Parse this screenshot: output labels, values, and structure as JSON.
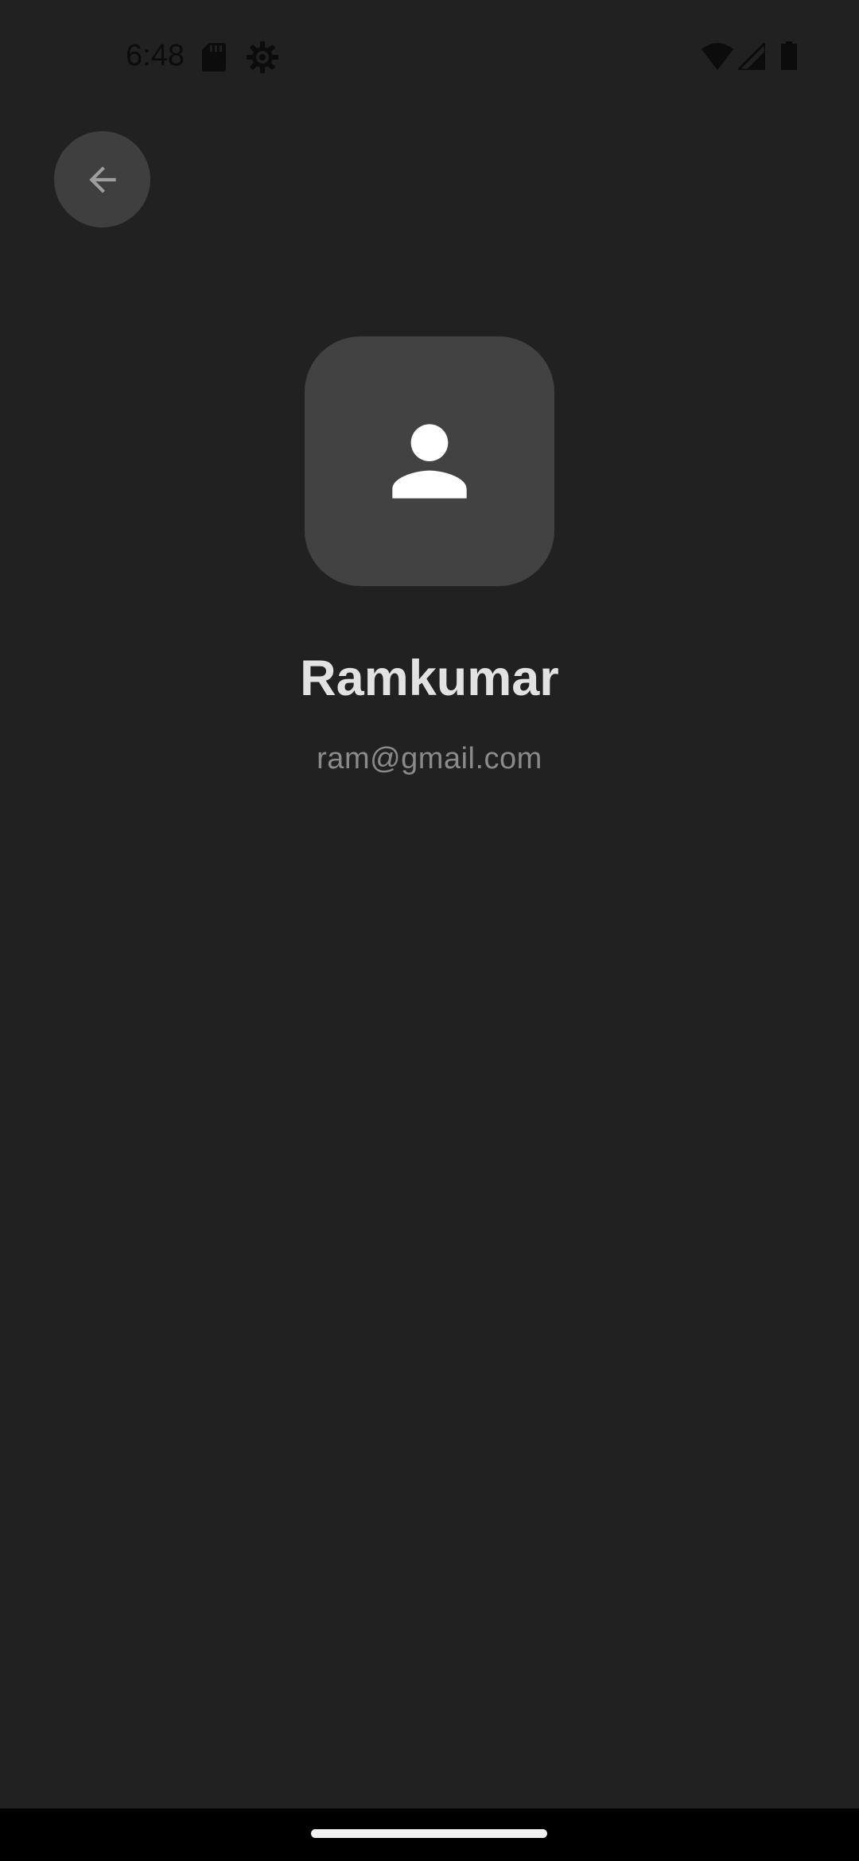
{
  "status_bar": {
    "time": "6:48",
    "icons": [
      "sd-card-icon",
      "settings-gear-icon",
      "wifi-icon",
      "cellular-signal-icon",
      "battery-icon"
    ]
  },
  "header": {
    "back_icon": "arrow-left-icon"
  },
  "profile": {
    "avatar_icon": "person-icon",
    "name": "Ramkumar",
    "email": "ram@gmail.com"
  },
  "colors": {
    "background": "#212121",
    "avatar_bg": "#424242",
    "back_button_bg": "#3f3f3f",
    "name_text": "#e2e2e2",
    "email_text": "#8a8a8a"
  }
}
